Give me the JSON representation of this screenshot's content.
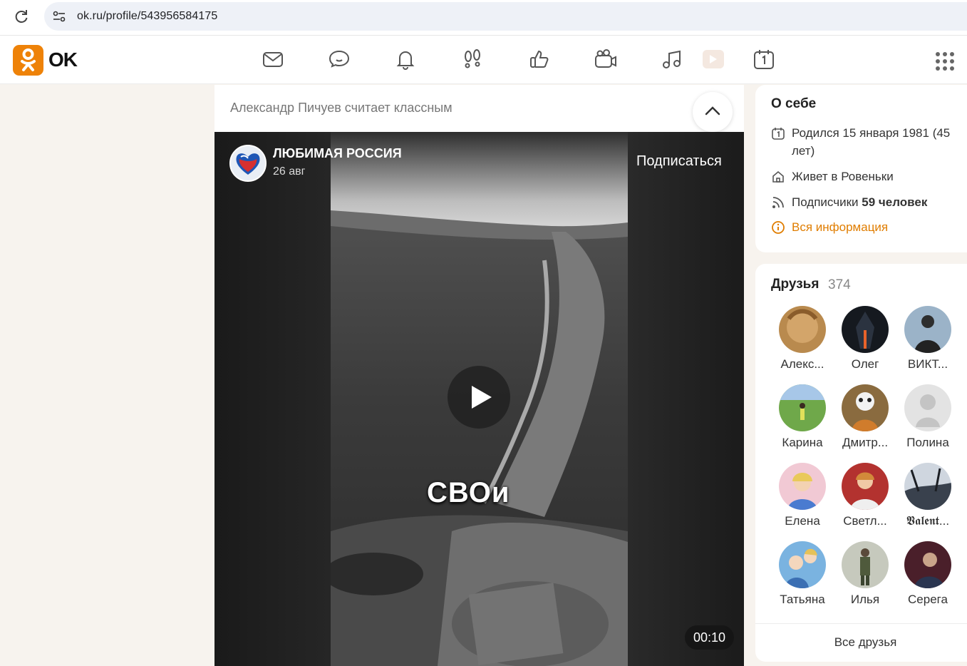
{
  "browser": {
    "url": "ok.ru/profile/543956584175"
  },
  "header": {
    "logo_text": "OK",
    "nav_icons": [
      "mail-icon",
      "chat-icon",
      "bell-icon",
      "guests-icon",
      "like-icon",
      "camera-icon",
      "music-icon",
      "video-icon",
      "calendar-icon"
    ]
  },
  "feed": {
    "liker_text": "Александр Пичуев считает классным",
    "post": {
      "channel_name": "ЛЮБИМАЯ РОССИЯ",
      "date": "26 авг",
      "subscribe_label": "Подписаться",
      "video_caption": "СВОи",
      "duration": "00:10"
    }
  },
  "about": {
    "title": "О себе",
    "birth": "Родился 15 января 1981 (45 лет)",
    "lives_prefix": "Живет в ",
    "lives_city": "Ровеньки",
    "subscribers_prefix": "Подписчики ",
    "subscribers_value": "59 человек",
    "all_info": "Вся информация"
  },
  "friends": {
    "title": "Друзья",
    "count": "374",
    "items": [
      {
        "name": "Алекс..."
      },
      {
        "name": "Олег"
      },
      {
        "name": "ВИКТ..."
      },
      {
        "name": "Карина"
      },
      {
        "name": "Дмитр..."
      },
      {
        "name": "Полина"
      },
      {
        "name": "Елена"
      },
      {
        "name": "Светл..."
      },
      {
        "name": "𝖁𝖆𝖑𝖊𝖓𝖙..."
      },
      {
        "name": "Татьяна"
      },
      {
        "name": "Илья"
      },
      {
        "name": "Серега"
      }
    ],
    "all_label": "Все друзья"
  },
  "colors": {
    "brand": "#ee8208",
    "link": "#e07d00",
    "page_bg": "#f7f3ee"
  }
}
